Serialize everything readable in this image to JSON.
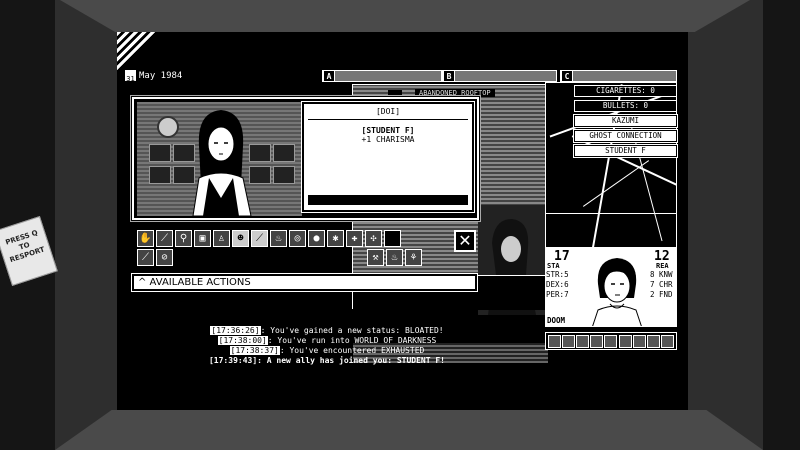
{
  "sticky_note": {
    "text": "PRESS Q TO RESPORT"
  },
  "date": {
    "day": "31",
    "label": "May 1984"
  },
  "tabs": [
    {
      "letter": "A"
    },
    {
      "letter": "B"
    },
    {
      "letter": "C"
    }
  ],
  "location": {
    "title": "ABANDONED ROOFTOP",
    "sub": "DOOM"
  },
  "stats_list": [
    {
      "label": "CIGARETTES: 0"
    },
    {
      "label": "BULLETS: 0"
    },
    {
      "label": "KAZUMI"
    },
    {
      "label": "GHOST CONNECTION"
    },
    {
      "label": "STUDENT F"
    }
  ],
  "character": {
    "sta_value": "17",
    "sta_label": "STA",
    "rea_value": "12",
    "rea_label": "REA",
    "stats_left": [
      {
        "label": "STR",
        "value": "5"
      },
      {
        "label": "DEX",
        "value": "6"
      },
      {
        "label": "PER",
        "value": "7"
      }
    ],
    "stats_right": [
      {
        "value": "8",
        "label": "KNW"
      },
      {
        "value": "7",
        "label": "CHR"
      },
      {
        "value": "2",
        "label": "FND"
      }
    ],
    "doom_label": "DOOM"
  },
  "event": {
    "header": "[DOI]",
    "status": "[STUDENT F]",
    "bonus": "+1 CHARISMA"
  },
  "actions_bar": {
    "label": "^ AVAILABLE ACTIONS"
  },
  "close_symbol": "✕",
  "log": [
    {
      "time": "[17:36:26]",
      "text": ": You've gained a new status: BLOATED!",
      "bold": false
    },
    {
      "time": "[17:38:00]",
      "text": ": You've run into WORLD OF DARKNESS",
      "bold": false
    },
    {
      "time": "[17:38:37]",
      "text": ": You've encountered EXHAUSTED",
      "bold": false
    },
    {
      "time": "[17:39:43]",
      "text": ": A new ally has joined you: STUDENT F!",
      "bold": true
    }
  ],
  "colors": {
    "screen_bg": "#000000",
    "frame": "#2e2e2e",
    "bezel": "#4a4a4a",
    "fg": "#ffffff"
  }
}
